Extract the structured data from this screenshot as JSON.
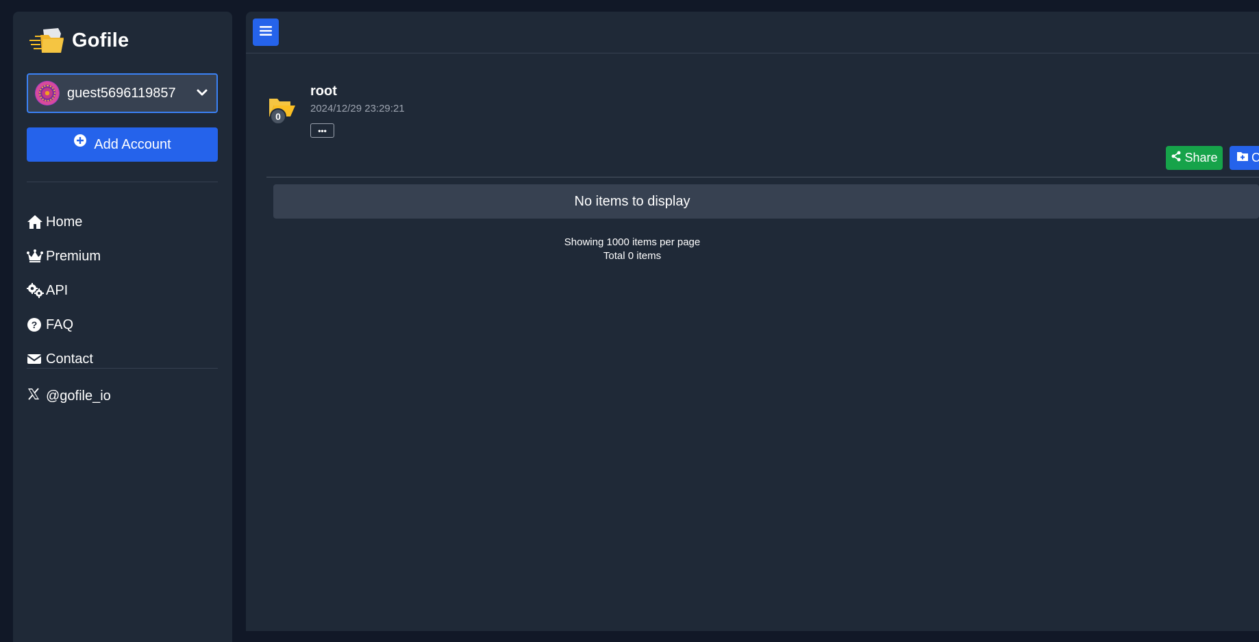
{
  "brand": {
    "name": "Gofile"
  },
  "account": {
    "username": "guest5696119857"
  },
  "buttons": {
    "add_account": "Add Account",
    "share": "Share",
    "create": "C",
    "more": "•••"
  },
  "nav": {
    "items": [
      {
        "label": "Home",
        "icon": "home-icon"
      },
      {
        "label": "Premium",
        "icon": "crown-icon"
      },
      {
        "label": "API",
        "icon": "gears-icon"
      },
      {
        "label": "FAQ",
        "icon": "question-circle-icon"
      },
      {
        "label": "Contact",
        "icon": "envelope-icon"
      }
    ],
    "social": {
      "label": "@gofile_io",
      "icon": "x-logo-icon"
    }
  },
  "folder": {
    "name": "root",
    "date": "2024/12/29 23:29:21",
    "count": "0"
  },
  "content": {
    "empty_message": "No items to display",
    "per_page": "Showing 1000 items per page",
    "total": "Total 0 items"
  },
  "colors": {
    "background": "#111827",
    "panel": "#1f2937",
    "primary": "#2563eb",
    "success": "#16a34a",
    "folder": "#fbbf24"
  }
}
